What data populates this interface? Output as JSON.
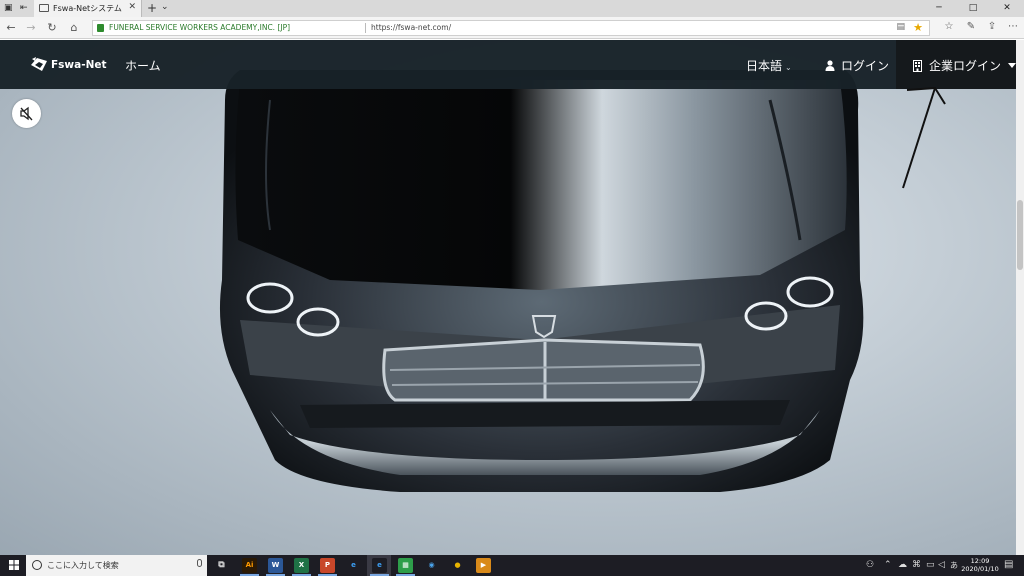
{
  "browser": {
    "tab_title": "Fswa-Netシステム",
    "new_tab_symbol": "+",
    "tab_close_symbol": "✕",
    "cert_label": "FUNERAL SERVICE WORKERS ACADEMY,INC. [JP]",
    "url": "https://fswa-net.com/"
  },
  "site": {
    "brand": "Fswa-Net",
    "nav_home": "ホーム",
    "nav_language": "日本語",
    "nav_login": "ログイン",
    "nav_corporate_login": "企業ログイン"
  },
  "taskbar": {
    "search_placeholder": "ここに入力して検索",
    "time": "12:09",
    "date": "2020/01/10",
    "apps": [
      {
        "name": "illustrator",
        "label": "Ai",
        "color": "#2b1a05",
        "fg": "#ff9a00"
      },
      {
        "name": "word",
        "label": "W",
        "color": "#2b5797",
        "fg": "#ffffff"
      },
      {
        "name": "excel-like",
        "label": "X",
        "color": "#1f7246",
        "fg": "#ffffff"
      },
      {
        "name": "powerpoint",
        "label": "P",
        "color": "#c8472a",
        "fg": "#ffffff"
      },
      {
        "name": "internet-explorer",
        "label": "e",
        "color": "#1d1d24",
        "fg": "#3c9df0"
      },
      {
        "name": "edge",
        "label": "e",
        "color": "#1d1d24",
        "fg": "#3c9df0"
      },
      {
        "name": "sheets",
        "label": "▦",
        "color": "#2e9e4a",
        "fg": "#ffffff"
      },
      {
        "name": "outlook-like",
        "label": "◉",
        "color": "#1d1d24",
        "fg": "#4aa3ea"
      },
      {
        "name": "chrome",
        "label": "●",
        "color": "#1d1d24",
        "fg": "#e8b400"
      },
      {
        "name": "media-player",
        "label": "▶",
        "color": "#d98a1a",
        "fg": "#ffffff"
      }
    ]
  }
}
